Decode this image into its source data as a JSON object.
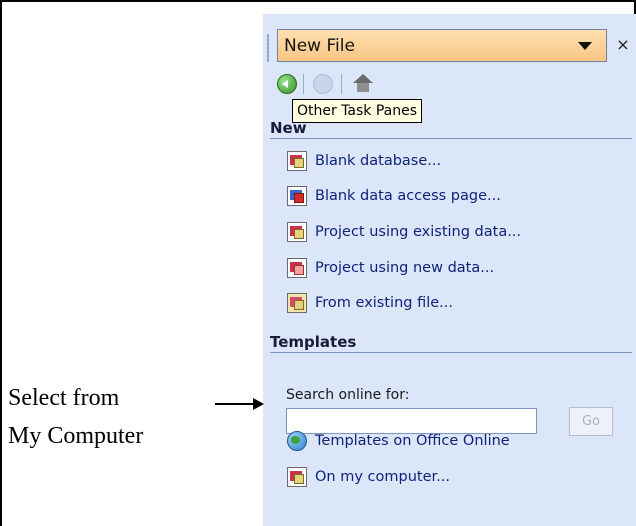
{
  "task_pane": {
    "title": "New File",
    "close_glyph": "×",
    "toolbar": {
      "tooltip": "Other Task Panes",
      "buttons": [
        "back-icon",
        "forward-icon",
        "home-icon"
      ]
    },
    "new_section": {
      "heading": "New",
      "items": [
        {
          "label": "Blank database...",
          "icon": "blank-database-icon"
        },
        {
          "label": "Blank data access page...",
          "icon": "data-access-page-icon"
        },
        {
          "label": "Project using existing data...",
          "icon": "project-existing-data-icon"
        },
        {
          "label": "Project using new data...",
          "icon": "project-new-data-icon"
        },
        {
          "label": "From existing file...",
          "icon": "existing-file-icon"
        }
      ]
    },
    "templates_section": {
      "heading": "Templates",
      "search_label": "Search online for:",
      "search_value": "",
      "go_label": "Go",
      "items": [
        {
          "label": "Templates on Office Online",
          "icon": "globe-icon"
        },
        {
          "label": "On my computer...",
          "icon": "on-my-computer-icon"
        }
      ]
    }
  },
  "annotation": {
    "line1": "Select from",
    "line2": "My Computer"
  },
  "colors": {
    "pane_background": "#dbe6f8",
    "title_bar": "#f7c583",
    "link_text": "#10227a",
    "tooltip_background": "#ffffe1"
  }
}
